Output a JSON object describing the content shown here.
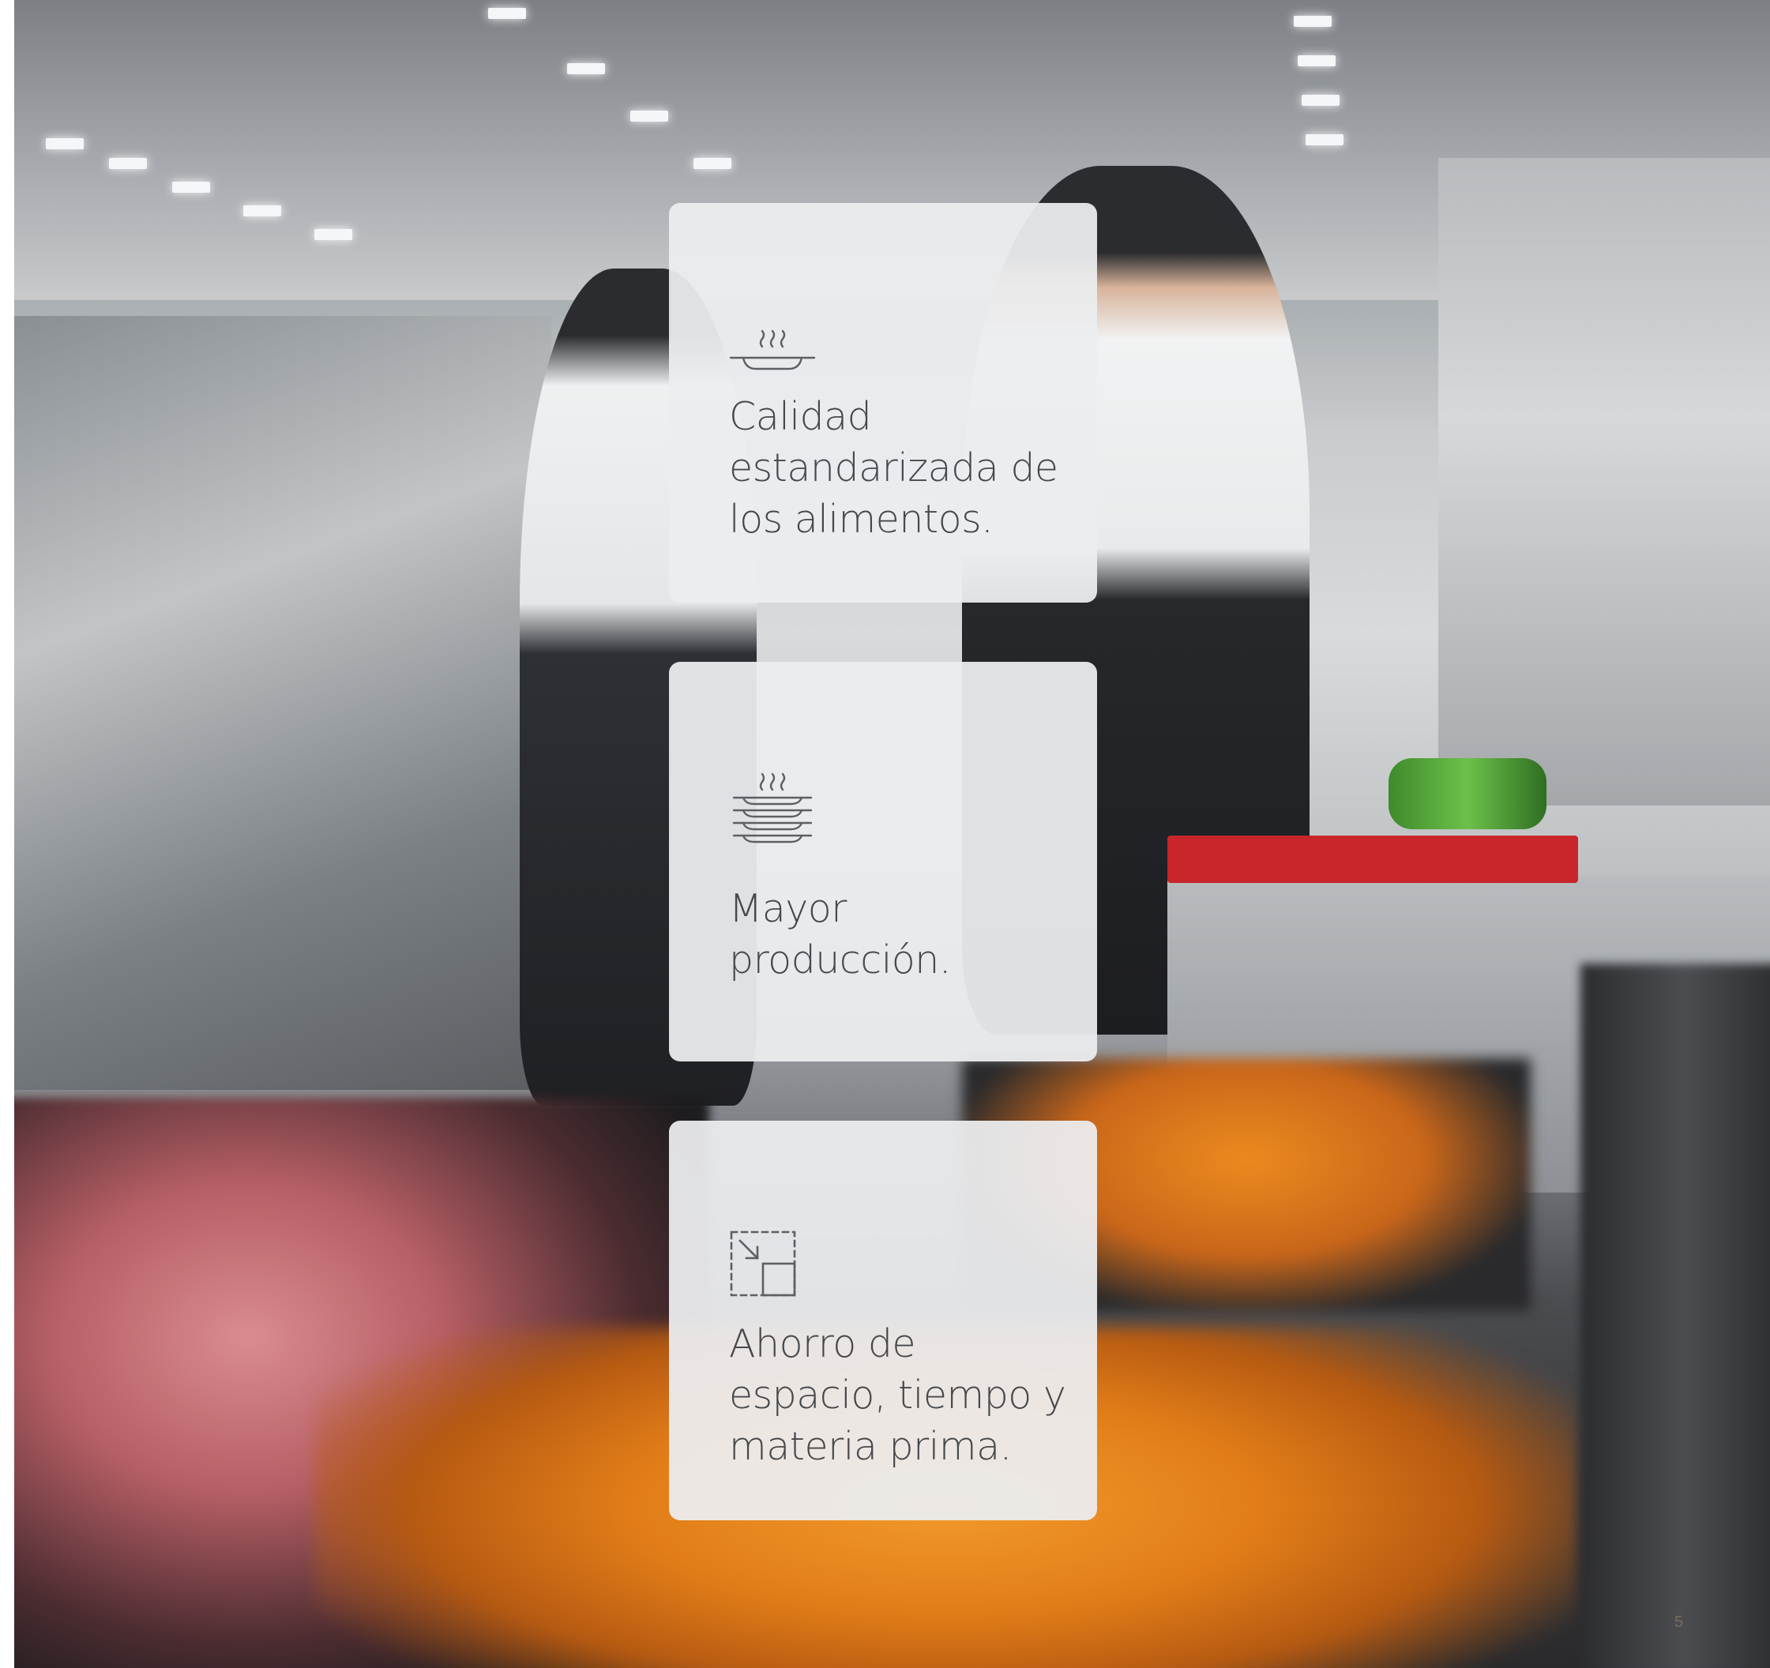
{
  "benefits": [
    {
      "text": "Calidad estandarizada de los alimentos.",
      "icon": "steaming-plate-icon"
    },
    {
      "text": "Mayor producción.",
      "icon": "stacked-plates-icon"
    },
    {
      "text": "Ahorro de espacio, tiempo y materia prima.",
      "icon": "resize-arrow-icon"
    }
  ],
  "page_number": "5",
  "colors": {
    "card_background": "#ecedef",
    "text": "#45484c",
    "icon_stroke": "#5c5f63"
  }
}
